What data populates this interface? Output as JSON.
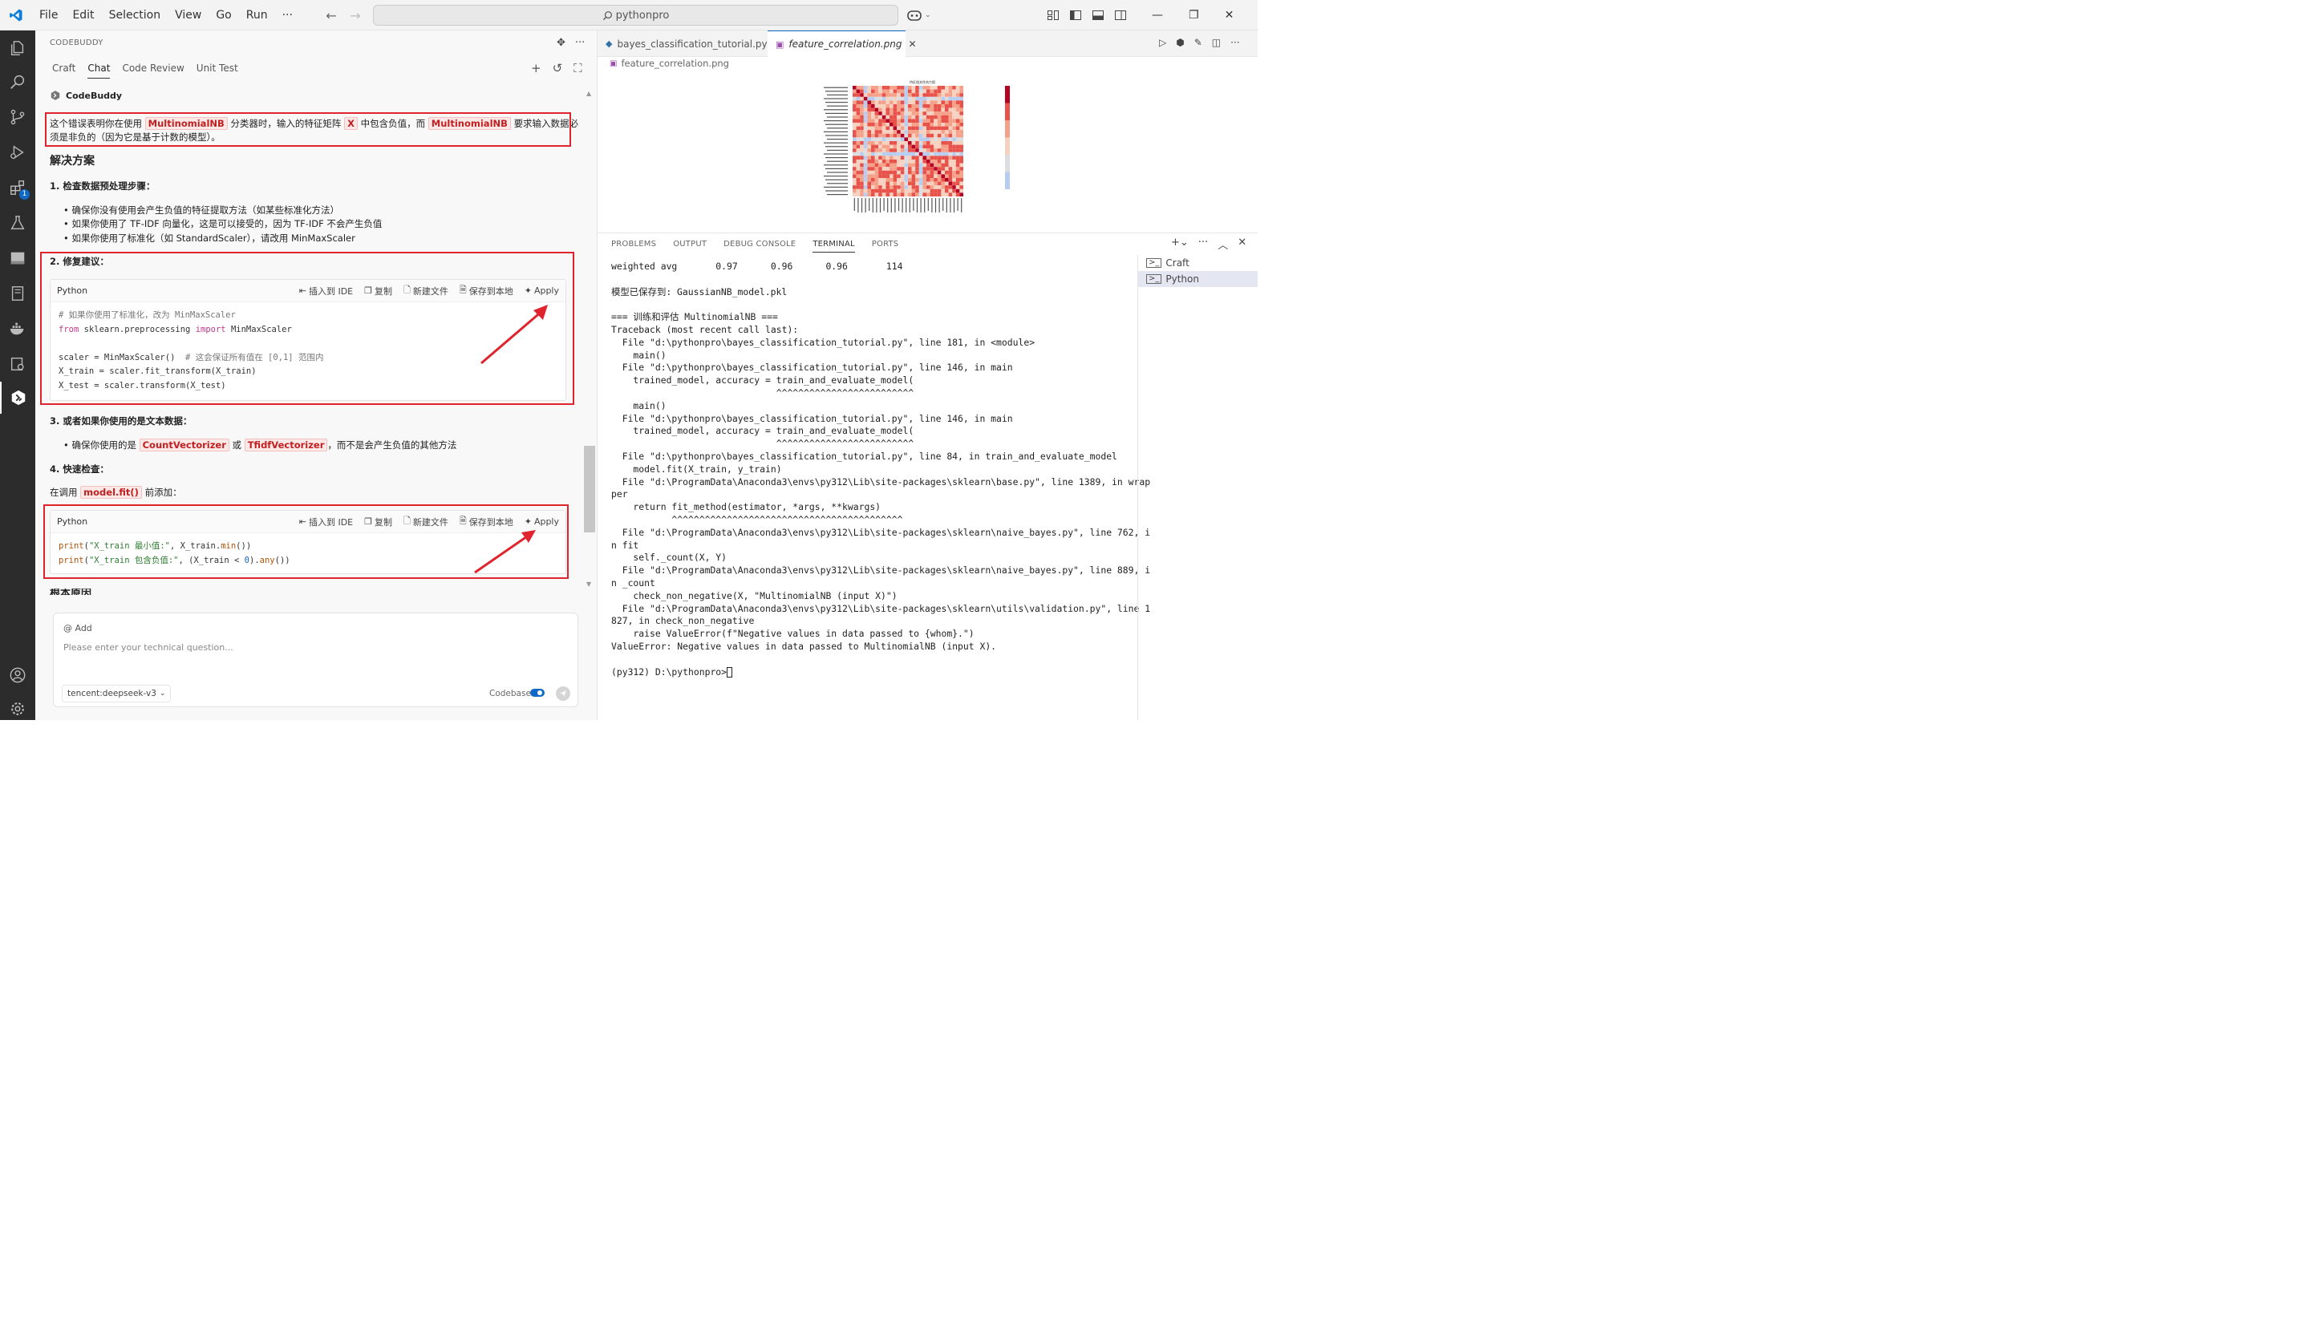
{
  "titlebar": {
    "menus": [
      "File",
      "Edit",
      "Selection",
      "View",
      "Go",
      "Run",
      "···"
    ],
    "search": "pythonpro"
  },
  "codebuddy": {
    "header": "CODEBUDDY",
    "tabs": [
      "Craft",
      "Chat",
      "Code Review",
      "Unit Test"
    ],
    "active_tab": "Chat",
    "assistant_name": "CodeBuddy",
    "intro": {
      "p1": "这个错误表明你在使用",
      "h1": "MultinomialNB",
      "p2": "分类器时，输入的特征矩阵",
      "h2": "X",
      "p3": "中包含负值，而",
      "h3": "MultinomialNB",
      "p4": "要求输入数据必",
      "line2": "须是非负的（因为它是基于计数的模型）。"
    },
    "solution_heading": "解决方案",
    "step1": "1. 检查数据预处理步骤：",
    "bullets1": [
      "确保你没有使用会产生负值的特征提取方法（如某些标准化方法）",
      "如果你使用了 TF-IDF 向量化，这是可以接受的，因为 TF-IDF 不会产生负值",
      "如果你使用了标准化（如 StandardScaler），请改用 MinMaxScaler"
    ],
    "step2": "2. 修复建议：",
    "code_actions": [
      "插入到 IDE",
      "复制",
      "新建文件",
      "保存到本地",
      "Apply"
    ],
    "code1": {
      "lang": "Python",
      "l1": "# 如果你使用了标准化，改为 MinMaxScaler",
      "l2_kw1": "from",
      "l2_a": " sklearn.preprocessing ",
      "l2_kw2": "import",
      "l2_b": " MinMaxScaler",
      "l3_a": "scaler = MinMaxScaler()  ",
      "l3_cm": "# 这会保证所有值在 [0,1] 范围内",
      "l4": "X_train = scaler.fit_transform(X_train)",
      "l5": "X_test = scaler.transform(X_test)"
    },
    "step3": "3. 或者如果你使用的是文本数据：",
    "bullet3": {
      "a": "确保你使用的是",
      "h1": "CountVectorizer",
      "b": "或",
      "h2": "TfidfVectorizer",
      "c": "，而不是会产生负值的其他方法"
    },
    "step4": "4. 快速检查：",
    "step4_text": {
      "a": "在调用",
      "h": "model.fit()",
      "b": "前添加："
    },
    "code2": {
      "lang": "Python",
      "l1_fn": "print",
      "l1_str": "\"X_train 最小值:\"",
      "l1_rest": ", X_train.",
      "l1_fn2": "min",
      "l1_end": "())",
      "l2_fn": "print",
      "l2_str": "\"X_train 包含负值:\"",
      "l2_rest": ", (X_train < ",
      "l2_num": "0",
      "l2_rest2": ").",
      "l2_fn2": "any",
      "l2_end": "())"
    },
    "cutoff_heading": "根本原因",
    "input": {
      "add": "@ Add",
      "placeholder": "Please enter your technical question...",
      "model": "tencent:deepseek-v3",
      "codebase": "Codebase"
    }
  },
  "editor": {
    "tabs": [
      "bayes_classification_tutorial.py",
      "feature_correlation.png"
    ],
    "active_tab": "feature_correlation.png",
    "breadcrumb": "feature_correlation.png",
    "image_title": "特征相关性热力图"
  },
  "panel": {
    "tabs": [
      "PROBLEMS",
      "OUTPUT",
      "DEBUG CONSOLE",
      "TERMINAL",
      "PORTS"
    ],
    "active_tab": "TERMINAL",
    "terminal_lines": [
      "weighted avg       0.97      0.96      0.96       114",
      "",
      "模型已保存到: GaussianNB_model.pkl",
      "",
      "=== 训练和评估 MultinomialNB ===",
      "Traceback (most recent call last):",
      "  File \"d:\\pythonpro\\bayes_classification_tutorial.py\", line 181, in <module>",
      "    main()",
      "  File \"d:\\pythonpro\\bayes_classification_tutorial.py\", line 146, in main",
      "    trained_model, accuracy = train_and_evaluate_model(",
      "                              ^^^^^^^^^^^^^^^^^^^^^^^^^",
      "    main()",
      "  File \"d:\\pythonpro\\bayes_classification_tutorial.py\", line 146, in main",
      "    trained_model, accuracy = train_and_evaluate_model(",
      "                              ^^^^^^^^^^^^^^^^^^^^^^^^^",
      "  File \"d:\\pythonpro\\bayes_classification_tutorial.py\", line 84, in train_and_evaluate_model",
      "    model.fit(X_train, y_train)",
      "  File \"d:\\ProgramData\\Anaconda3\\envs\\py312\\Lib\\site-packages\\sklearn\\base.py\", line 1389, in wrap",
      "per",
      "    return fit_method(estimator, *args, **kwargs)",
      "           ^^^^^^^^^^^^^^^^^^^^^^^^^^^^^^^^^^^^^^^^^^",
      "  File \"d:\\ProgramData\\Anaconda3\\envs\\py312\\Lib\\site-packages\\sklearn\\naive_bayes.py\", line 762, i",
      "n fit",
      "    self._count(X, Y)",
      "  File \"d:\\ProgramData\\Anaconda3\\envs\\py312\\Lib\\site-packages\\sklearn\\naive_bayes.py\", line 889, i",
      "n _count",
      "    check_non_negative(X, \"MultinomialNB (input X)\")",
      "  File \"d:\\ProgramData\\Anaconda3\\envs\\py312\\Lib\\site-packages\\sklearn\\utils\\validation.py\", line 1",
      "827, in check_non_negative",
      "    raise ValueError(f\"Negative values in data passed to {whom}.\")",
      "ValueError: Negative values in data passed to MultinomialNB (input X).",
      "",
      "(py312) D:\\pythonpro>"
    ],
    "terminal_list": [
      "Craft",
      "Python"
    ],
    "selected_terminal": "Python"
  },
  "colors": {
    "accent": "#0e68c4",
    "highlight_box": "#e0242d",
    "activity_bar": "#2c2c2c"
  }
}
